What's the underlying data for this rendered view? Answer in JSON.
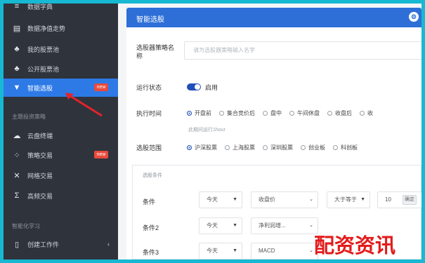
{
  "sidebar": {
    "items": [
      {
        "label": "数据字典",
        "icon": "layers-icon",
        "active": false,
        "badge": null
      },
      {
        "label": "数据净值走势",
        "icon": "chart-icon",
        "active": false,
        "badge": null
      },
      {
        "label": "我的股票池",
        "icon": "group-icon",
        "active": false,
        "badge": null
      },
      {
        "label": "公开股票池",
        "icon": "group-icon",
        "active": false,
        "badge": null
      },
      {
        "label": "智能选股",
        "icon": "filter-icon",
        "active": true,
        "badge": "new"
      }
    ],
    "group2_title": "主题投资策略",
    "items2": [
      {
        "label": "云盘终端",
        "icon": "cloud-icon",
        "active": false,
        "badge": null
      },
      {
        "label": "策略交易",
        "icon": "network-icon",
        "active": false,
        "badge": "new"
      },
      {
        "label": "网格交易",
        "icon": "shuffle-icon",
        "active": false,
        "badge": null
      },
      {
        "label": "高频交易",
        "icon": "sigma-icon",
        "active": false,
        "badge": null
      }
    ],
    "group3_title": "智能化学习",
    "items3": [
      {
        "label": "创建工作件",
        "icon": "document-icon",
        "active": false,
        "badge": null
      }
    ]
  },
  "panel": {
    "title": "智能选股",
    "strategy_label": "选股器策略名称",
    "strategy_placeholder": "请为选股器策略输入名字",
    "status_label": "运行状态",
    "status_value": "启用",
    "time_label": "执行时间",
    "time_options": [
      {
        "label": "开盘前",
        "selected": true
      },
      {
        "label": "集合竞价后",
        "selected": false
      },
      {
        "label": "盘中",
        "selected": false
      },
      {
        "label": "午间休盘",
        "selected": false
      },
      {
        "label": "收盘后",
        "selected": false
      },
      {
        "label": "收",
        "selected": false
      }
    ],
    "hint": "此期间运行1hour",
    "scope_label": "选股范围",
    "scope_options": [
      {
        "label": "沪深股票",
        "selected": true
      },
      {
        "label": "上海股票",
        "selected": false
      },
      {
        "label": "深圳股票",
        "selected": false
      },
      {
        "label": "创业板",
        "selected": false
      },
      {
        "label": "科创板",
        "selected": false
      }
    ],
    "conditions": {
      "title": "选股条件",
      "rows": [
        {
          "label": "条件",
          "day": "今天",
          "field": "收盘价",
          "op": "大于等于",
          "value": "10",
          "button": "确定"
        },
        {
          "label": "条件2",
          "day": "今天",
          "field": "净利润增...",
          "op": "",
          "value": "",
          "button": ""
        },
        {
          "label": "条件3",
          "day": "今天",
          "field": "MACD",
          "op": "",
          "value": "",
          "button": ""
        }
      ]
    }
  },
  "watermark": "配资资讯",
  "colors": {
    "sidebar_bg": "#2f333c",
    "accent": "#2e6fd7",
    "badge": "#e84a3c",
    "watermark": "#e31b1b"
  }
}
